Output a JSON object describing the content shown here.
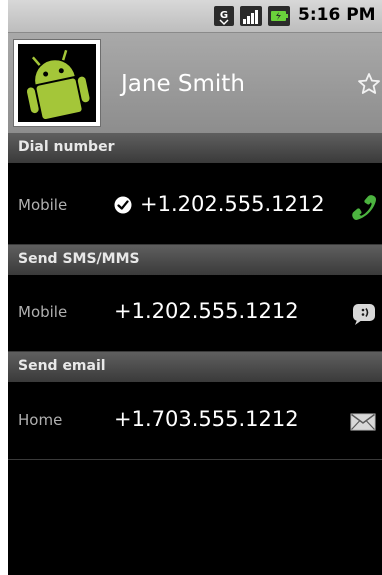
{
  "status_bar": {
    "time": "5:16 PM",
    "icons": [
      "gps-icon",
      "signal-icon",
      "battery-icon"
    ]
  },
  "contact": {
    "name": "Jane Smith",
    "photo_icon": "android-robot-icon",
    "favorite_icon": "star-icon",
    "favorite": false
  },
  "sections": [
    {
      "header": "Dial number",
      "rows": [
        {
          "type": "Mobile",
          "value": "+1.202.555.1212",
          "is_default": true,
          "action_icon": "phone-icon"
        }
      ]
    },
    {
      "header": "Send SMS/MMS",
      "rows": [
        {
          "type": "Mobile",
          "value": "+1.202.555.1212",
          "is_default": false,
          "action_icon": "sms-icon"
        }
      ]
    },
    {
      "header": "Send email",
      "rows": [
        {
          "type": "Home",
          "value": "+1.703.555.1212",
          "is_default": false,
          "action_icon": "email-icon"
        }
      ]
    }
  ],
  "colors": {
    "header_bg": "#9a9a9a",
    "section_header_bg": "#4a4a4a",
    "list_bg": "#000000",
    "android_green": "#a4c639",
    "phone_green": "#3ea33a"
  }
}
